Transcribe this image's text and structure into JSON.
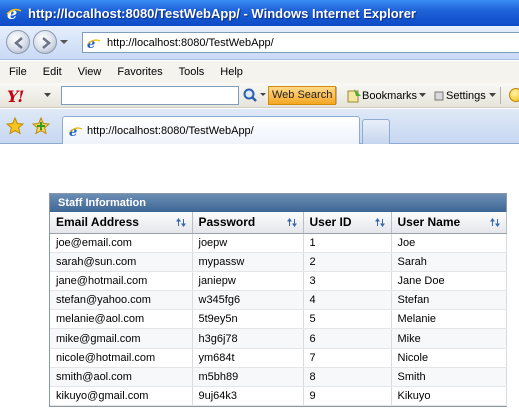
{
  "window": {
    "title": "http://localhost:8080/TestWebApp/ - Windows Internet Explorer"
  },
  "address_bar": {
    "url": "http://localhost:8080/TestWebApp/"
  },
  "menu": {
    "items": [
      "File",
      "Edit",
      "View",
      "Favorites",
      "Tools",
      "Help"
    ]
  },
  "toolbar": {
    "search_value": "",
    "web_search_label": "Web Search",
    "bookmarks_label": "Bookmarks",
    "settings_label": "Settings"
  },
  "tab": {
    "label": "http://localhost:8080/TestWebApp/"
  },
  "panel": {
    "title": "Staff Information",
    "columns": [
      "Email Address",
      "Password",
      "User ID",
      "User Name"
    ],
    "rows": [
      [
        "joe@email.com",
        "joepw",
        "1",
        "Joe"
      ],
      [
        "sarah@sun.com",
        "mypassw",
        "2",
        "Sarah"
      ],
      [
        "jane@hotmail.com",
        "janiepw",
        "3",
        "Jane Doe"
      ],
      [
        "stefan@yahoo.com",
        "w345fg6",
        "4",
        "Stefan"
      ],
      [
        "melanie@aol.com",
        "5t9ey5n",
        "5",
        "Melanie"
      ],
      [
        "mike@gmail.com",
        "h3g6j78",
        "6",
        "Mike"
      ],
      [
        "nicole@hotmail.com",
        "ym684t",
        "7",
        "Nicole"
      ],
      [
        "smith@aol.com",
        "m5bh89",
        "8",
        "Smith"
      ],
      [
        "kikuyo@gmail.com",
        "9uj64k3",
        "9",
        "Kikuyo"
      ]
    ]
  },
  "colors": {
    "titlebar": "#1f63d9",
    "panel_header": "#4b7199"
  },
  "icons": [
    "ie-logo-icon",
    "back-icon",
    "forward-icon",
    "page-icon",
    "search-icon",
    "star-icon",
    "add-favorite-icon",
    "sort-icon",
    "smiley-icon"
  ]
}
